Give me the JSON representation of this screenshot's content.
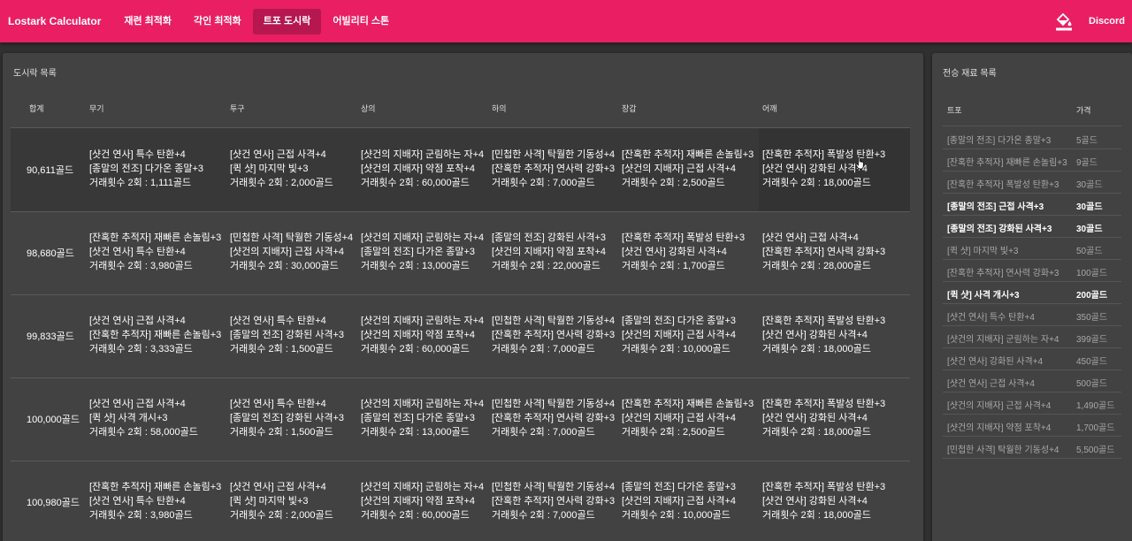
{
  "appbar": {
    "title": "Lostark Calculator",
    "tabs": [
      "재련 최적화",
      "각인 최적화",
      "트포 도시락",
      "어빌리티 스톤"
    ],
    "active_tab": 2,
    "discord_label": "Discord",
    "icons": [
      "paint-bucket-icon"
    ],
    "colors": {
      "primary": "#e91e63",
      "active_tab": "#b5174e",
      "background": "#303030",
      "card": "#424242"
    }
  },
  "main": {
    "title": "도시락 목록",
    "columns": [
      "합계",
      "무기",
      "투구",
      "상의",
      "하의",
      "장갑",
      "어깨"
    ],
    "rows": [
      {
        "total": "90,611골드",
        "cells": [
          [
            "[샷건 연사] 특수 탄환+4",
            "[종말의 전조] 다가온 종말+3",
            "거래횟수 2회 : 1,111골드"
          ],
          [
            "[샷건 연사] 근접 사격+4",
            "[퀵 샷] 마지막 빛+3",
            "거래횟수 2회 : 2,000골드"
          ],
          [
            "[샷건의 지배자] 군림하는 자+4",
            "[샷건의 지배자] 약점 포착+4",
            "거래횟수 2회 : 60,000골드"
          ],
          [
            "[민첩한 사격] 탁월한 기동성+4",
            "[잔혹한 추적자] 연사력 강화+3",
            "거래횟수 2회 : 7,000골드"
          ],
          [
            "[잔혹한 추적자] 재빠른 손놀림+3",
            "[샷건의 지배자] 근접 사격+4",
            "거래횟수 2회 : 2,500골드"
          ],
          [
            "[잔혹한 추적자] 폭발성 탄환+3",
            "[샷건 연사] 강화된 사격+4",
            "거래횟수 2회 : 18,000골드"
          ]
        ]
      },
      {
        "total": "98,680골드",
        "cells": [
          [
            "[잔혹한 추적자] 재빠른 손놀림+3",
            "[샷건 연사] 특수 탄환+4",
            "거래횟수 2회 : 3,980골드"
          ],
          [
            "[민첩한 사격] 탁월한 기동성+4",
            "[샷건의 지배자] 근접 사격+4",
            "거래횟수 2회 : 30,000골드"
          ],
          [
            "[샷건의 지배자] 군림하는 자+4",
            "[종말의 전조] 다가온 종말+3",
            "거래횟수 2회 : 13,000골드"
          ],
          [
            "[종말의 전조] 강화된 사격+3",
            "[샷건의 지배자] 약점 포착+4",
            "거래횟수 2회 : 22,000골드"
          ],
          [
            "[잔혹한 추적자] 폭발성 탄환+3",
            "[샷건 연사] 강화된 사격+4",
            "거래횟수 2회 : 1,700골드"
          ],
          [
            "[샷건 연사] 근접 사격+4",
            "[잔혹한 추적자] 연사력 강화+3",
            "거래횟수 2회 : 28,000골드"
          ]
        ]
      },
      {
        "total": "99,833골드",
        "cells": [
          [
            "[샷건 연사] 근접 사격+4",
            "[잔혹한 추적자] 재빠른 손놀림+3",
            "거래횟수 2회 : 3,333골드"
          ],
          [
            "[샷건 연사] 특수 탄환+4",
            "[종말의 전조] 강화된 사격+3",
            "거래횟수 2회 : 1,500골드"
          ],
          [
            "[샷건의 지배자] 군림하는 자+4",
            "[샷건의 지배자] 약점 포착+4",
            "거래횟수 2회 : 60,000골드"
          ],
          [
            "[민첩한 사격] 탁월한 기동성+4",
            "[잔혹한 추적자] 연사력 강화+3",
            "거래횟수 2회 : 7,000골드"
          ],
          [
            "[종말의 전조] 다가온 종말+3",
            "[샷건의 지배자] 근접 사격+4",
            "거래횟수 2회 : 10,000골드"
          ],
          [
            "[잔혹한 추적자] 폭발성 탄환+3",
            "[샷건 연사] 강화된 사격+4",
            "거래횟수 2회 : 18,000골드"
          ]
        ]
      },
      {
        "total": "100,000골드",
        "cells": [
          [
            "[샷건 연사] 근접 사격+4",
            "[퀵 샷] 사격 개시+3",
            "거래횟수 2회 : 58,000골드"
          ],
          [
            "[샷건 연사] 특수 탄환+4",
            "[종말의 전조] 강화된 사격+3",
            "거래횟수 2회 : 1,500골드"
          ],
          [
            "[샷건의 지배자] 군림하는 자+4",
            "[종말의 전조] 다가온 종말+3",
            "거래횟수 2회 : 13,000골드"
          ],
          [
            "[민첩한 사격] 탁월한 기동성+4",
            "[잔혹한 추적자] 연사력 강화+3",
            "거래횟수 2회 : 7,000골드"
          ],
          [
            "[잔혹한 추적자] 재빠른 손놀림+3",
            "[샷건의 지배자] 근접 사격+4",
            "거래횟수 2회 : 2,500골드"
          ],
          [
            "[잔혹한 추적자] 폭발성 탄환+3",
            "[샷건 연사] 강화된 사격+4",
            "거래횟수 2회 : 18,000골드"
          ]
        ]
      },
      {
        "total": "100,980골드",
        "cells": [
          [
            "[잔혹한 추적자] 재빠른 손놀림+3",
            "[샷건 연사] 특수 탄환+4",
            "거래횟수 2회 : 3,980골드"
          ],
          [
            "[샷건 연사] 근접 사격+4",
            "[퀵 샷] 마지막 빛+3",
            "거래횟수 2회 : 2,000골드"
          ],
          [
            "[샷건의 지배자] 군림하는 자+4",
            "[샷건의 지배자] 약점 포착+4",
            "거래횟수 2회 : 60,000골드"
          ],
          [
            "[민첩한 사격] 탁월한 기동성+4",
            "[잔혹한 추적자] 연사력 강화+3",
            "거래횟수 2회 : 7,000골드"
          ],
          [
            "[종말의 전조] 다가온 종말+3",
            "[샷건의 지배자] 근접 사격+4",
            "거래횟수 2회 : 10,000골드"
          ],
          [
            "[잔혹한 추적자] 폭발성 탄환+3",
            "[샷건 연사] 강화된 사격+4",
            "거래횟수 2회 : 18,000골드"
          ]
        ]
      }
    ]
  },
  "side": {
    "title": "전승 재료 목록",
    "columns": [
      "트포",
      "가격"
    ],
    "items": [
      {
        "name": "[종말의 전조] 다가온 종말+3",
        "price": "5골드",
        "bright": false
      },
      {
        "name": "[잔혹한 추적자] 재빠른 손놀림+3",
        "price": "9골드",
        "bright": false
      },
      {
        "name": "[잔혹한 추적자] 폭발성 탄환+3",
        "price": "30골드",
        "bright": false
      },
      {
        "name": "[종말의 전조] 근접 사격+3",
        "price": "30골드",
        "bright": true
      },
      {
        "name": "[종말의 전조] 강화된 사격+3",
        "price": "30골드",
        "bright": true
      },
      {
        "name": "[퀵 샷] 마지막 빛+3",
        "price": "50골드",
        "bright": false
      },
      {
        "name": "[잔혹한 추적자] 연사력 강화+3",
        "price": "100골드",
        "bright": false
      },
      {
        "name": "[퀵 샷] 사격 개시+3",
        "price": "200골드",
        "bright": true
      },
      {
        "name": "[샷건 연사] 특수 탄환+4",
        "price": "350골드",
        "bright": false
      },
      {
        "name": "[샷건의 지배자] 군림하는 자+4",
        "price": "399골드",
        "bright": false
      },
      {
        "name": "[샷건 연사] 강화된 사격+4",
        "price": "450골드",
        "bright": false
      },
      {
        "name": "[샷건 연사] 근접 사격+4",
        "price": "500골드",
        "bright": false
      },
      {
        "name": "[샷건의 지배자] 근접 사격+4",
        "price": "1,490골드",
        "bright": false
      },
      {
        "name": "[샷건의 지배자] 약점 포착+4",
        "price": "1,700골드",
        "bright": false
      },
      {
        "name": "[민첩한 사격] 탁월한 기동성+4",
        "price": "5,500골드",
        "bright": false
      }
    ]
  }
}
